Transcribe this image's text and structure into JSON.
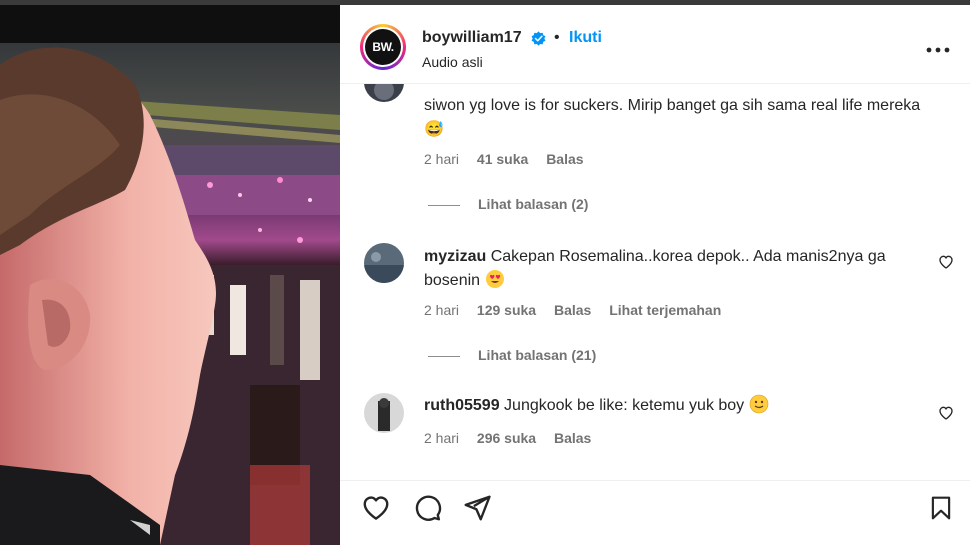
{
  "header": {
    "username": "boywilliam17",
    "separator": "•",
    "follow_label": "Ikuti",
    "subtitle": "Audio asli",
    "avatar_text": "BW."
  },
  "comments": [
    {
      "username": "",
      "text": "siwon yg love is for suckers. Mirip banget ga sih sama real life mereka😅",
      "time": "2 hari",
      "likes": "41 suka",
      "reply": "Balas",
      "view_replies": "Lihat balasan (2)"
    },
    {
      "username": "myzizau",
      "text": "Cakepan Rosemalina..korea depok.. Ada manis2nya ga bosenin",
      "emoji": "😍",
      "time": "2 hari",
      "likes": "129 suka",
      "reply": "Balas",
      "translate": "Lihat terjemahan",
      "view_replies": "Lihat balasan (21)"
    },
    {
      "username": "ruth05599",
      "text": "Jungkook be like: ketemu yuk boy",
      "emoji": "🙂",
      "time": "2 hari",
      "likes": "296 suka",
      "reply": "Balas"
    }
  ],
  "icons": {
    "verified": "verified-badge-icon",
    "more": "more-options-icon",
    "like": "heart-icon",
    "comment": "comment-icon",
    "share": "share-icon",
    "save": "bookmark-icon"
  },
  "colors": {
    "accent": "#0095f6",
    "text": "#262626",
    "muted": "#737373"
  }
}
